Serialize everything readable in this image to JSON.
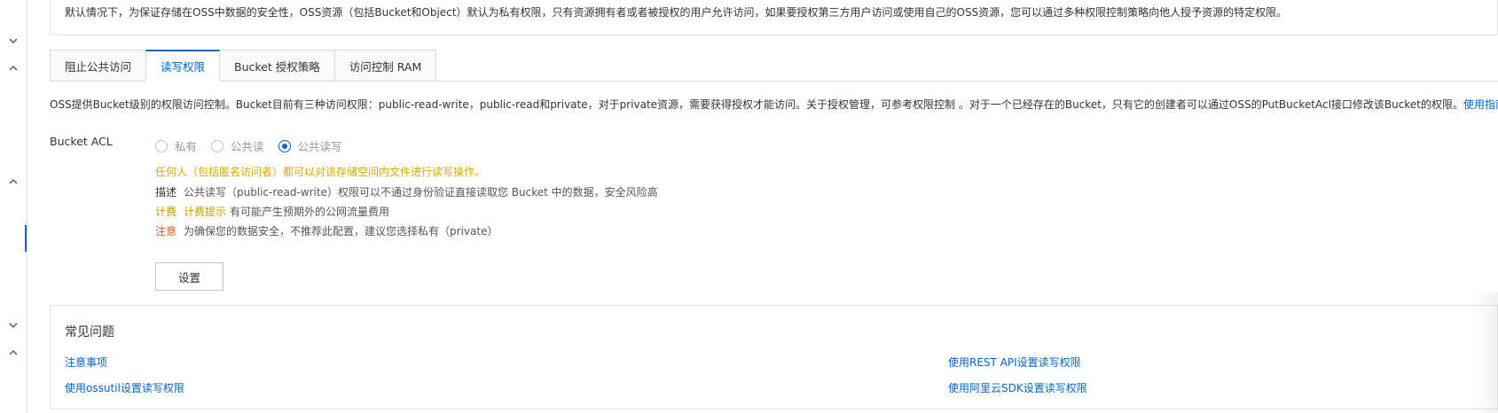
{
  "rail": {
    "chevrons": [
      "chevron-down-icon",
      "chevron-up-icon",
      "chevron-up-icon",
      "chevron-down-icon",
      "chevron-up-icon"
    ]
  },
  "notice": {
    "text": "默认情况下，为保证存储在OSS中数据的安全性，OSS资源（包括Bucket和Object）默认为私有权限，只有资源拥有者或者被授权的用户允许访问，如果要授权第三方用户访问或使用自己的OSS资源，您可以通过多种权限控制策略向他人授予资源的特定权限。"
  },
  "tabs": [
    {
      "label": "阻止公共访问",
      "active": false
    },
    {
      "label": "读写权限",
      "active": true
    },
    {
      "label": "Bucket 授权策略",
      "active": false
    },
    {
      "label": "访问控制 RAM",
      "active": false
    }
  ],
  "description": {
    "text": "OSS提供Bucket级别的权限访问控制。Bucket目前有三种访问权限：public-read-write，public-read和private，对于private资源，需要获得授权才能访问。关于授权管理，可参考权限控制 。对于一个已经存在的Bucket，只有它的创建者可以通过OSS的PutBucketAcl接口修改该Bucket的权限。",
    "link": "使用指南"
  },
  "acl": {
    "label": "Bucket ACL",
    "options": [
      {
        "label": "私有",
        "checked": false
      },
      {
        "label": "公共读",
        "checked": false
      },
      {
        "label": "公共读写",
        "checked": true
      }
    ],
    "warning": "任何人（包括匿名访问者）都可以对该存储空间内文件进行读写操作。",
    "desc_key": "描述",
    "desc_text": "公共读写（public-read-write）权限可以不通过身份验证直接读取您 Bucket 中的数据，安全风险高",
    "fee_key": "计费",
    "fee_tip": "计费提示",
    "fee_text": "有可能产生预期外的公网流量费用",
    "note_key": "注意",
    "note_text": "为确保您的数据安全，不推荐此配置，建议您选择私有（private）",
    "button": "设置"
  },
  "faq": {
    "title": "常见问题",
    "links": [
      "注意事项",
      "使用REST API设置读写权限",
      "使用ossutil设置读写权限",
      "使用阿里云SDK设置读写权限"
    ]
  },
  "colors": {
    "accent": "#0064c8",
    "warning": "#d9a800",
    "danger": "#e05d0c"
  }
}
